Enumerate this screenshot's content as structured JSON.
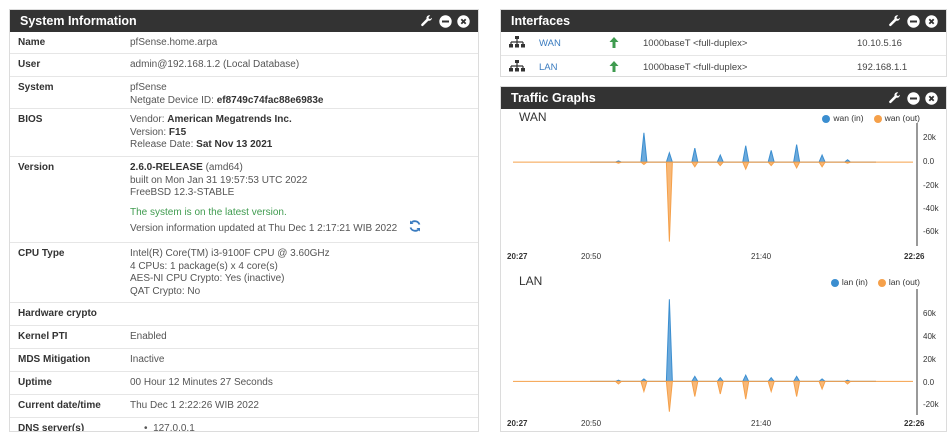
{
  "colors": {
    "header_bg": "#333333",
    "wan_in": "#3b8ed0",
    "wan_out": "#f5a04a",
    "status_green": "#3f9b4f",
    "link_blue": "#3a7bbf"
  },
  "sysinfo": {
    "title": "System Information",
    "rows": {
      "name": {
        "label": "Name",
        "value": "pfSense.home.arpa"
      },
      "user": {
        "label": "User",
        "value": "admin@192.168.1.2 (Local Database)"
      },
      "system": {
        "label": "System",
        "line1": "pfSense",
        "ndid_prefix": "Netgate Device ID: ",
        "ndid": "ef8749c74fac88e6983e"
      },
      "bios": {
        "label": "BIOS",
        "vendor_prefix": "Vendor: ",
        "vendor": "American Megatrends Inc.",
        "version_prefix": "Version: ",
        "version": "F15",
        "date_prefix": "Release Date: ",
        "date": "Sat Nov 13 2021"
      },
      "version": {
        "label": "Version",
        "release": "2.6.0-RELEASE",
        "arch": " (amd64)",
        "built": "built on Mon Jan 31 19:57:53 UTC 2022",
        "freebsd": "FreeBSD 12.3-STABLE",
        "latest": "The system is on the latest version.",
        "updated": "Version information updated at Thu Dec 1 2:17:21 WIB 2022"
      },
      "cpu": {
        "label": "CPU Type",
        "line1": "Intel(R) Core(TM) i3-9100F CPU @ 3.60GHz",
        "line2": "4 CPUs: 1 package(s) x 4 core(s)",
        "line3": "AES-NI CPU Crypto: Yes (inactive)",
        "line4": "QAT Crypto: No"
      },
      "hwcrypto": {
        "label": "Hardware crypto",
        "value": ""
      },
      "kpti": {
        "label": "Kernel PTI",
        "value": "Enabled"
      },
      "mds": {
        "label": "MDS Mitigation",
        "value": "Inactive"
      },
      "uptime": {
        "label": "Uptime",
        "value": "00 Hour 12 Minutes 27 Seconds"
      },
      "datetime": {
        "label": "Current date/time",
        "value": "Thu Dec 1 2:22:26 WIB 2022"
      },
      "dns": {
        "label": "DNS server(s)",
        "value": "127.0.0.1"
      }
    }
  },
  "interfaces": {
    "title": "Interfaces",
    "rows": [
      {
        "name": "WAN",
        "media": "1000baseT <full-duplex>",
        "ip": "10.10.5.16"
      },
      {
        "name": "LAN",
        "media": "1000baseT <full-duplex>",
        "ip": "192.168.1.1"
      }
    ]
  },
  "traffic": {
    "title": "Traffic Graphs",
    "wan": {
      "title": "WAN",
      "legend_in": "wan (in)",
      "legend_out": "wan (out)",
      "yticks": [
        "20k",
        "0.0",
        "-20k",
        "-40k",
        "-60k"
      ],
      "xticks": [
        "20:27",
        "20:50",
        "21:40",
        "22:26"
      ]
    },
    "lan": {
      "title": "LAN",
      "legend_in": "lan (in)",
      "legend_out": "lan (out)",
      "yticks": [
        "60k",
        "40k",
        "20k",
        "0.0",
        "-20k"
      ],
      "xticks": [
        "20:27",
        "20:50",
        "21:40",
        "22:26"
      ]
    }
  },
  "chart_data": [
    {
      "type": "area",
      "title": "WAN",
      "x": [
        "20:27",
        "20:50",
        "21:40",
        "22:26"
      ],
      "ylim": [
        -70000,
        30000
      ],
      "series": [
        {
          "name": "wan (in)",
          "color": "#3b8ed0",
          "values": [
            0,
            1000,
            25000,
            8000,
            12000,
            6000,
            14000,
            10000,
            15000,
            6000,
            2000,
            0
          ]
        },
        {
          "name": "wan (out)",
          "color": "#f5a04a",
          "values": [
            0,
            -1000,
            -2000,
            -68000,
            -4000,
            -3000,
            -6000,
            -3000,
            -5000,
            -4000,
            -1000,
            0
          ]
        }
      ]
    },
    {
      "type": "area",
      "title": "LAN",
      "x": [
        "20:27",
        "20:50",
        "21:40",
        "22:26"
      ],
      "ylim": [
        -25000,
        70000
      ],
      "series": [
        {
          "name": "lan (in)",
          "color": "#3b8ed0",
          "values": [
            0,
            1000,
            2000,
            65000,
            4000,
            3000,
            5000,
            3000,
            4000,
            2000,
            1000,
            0
          ]
        },
        {
          "name": "lan (out)",
          "color": "#f5a04a",
          "values": [
            0,
            -2000,
            -8000,
            -24000,
            -12000,
            -10000,
            -14000,
            -8000,
            -12000,
            -6000,
            -2000,
            0
          ]
        }
      ]
    }
  ]
}
